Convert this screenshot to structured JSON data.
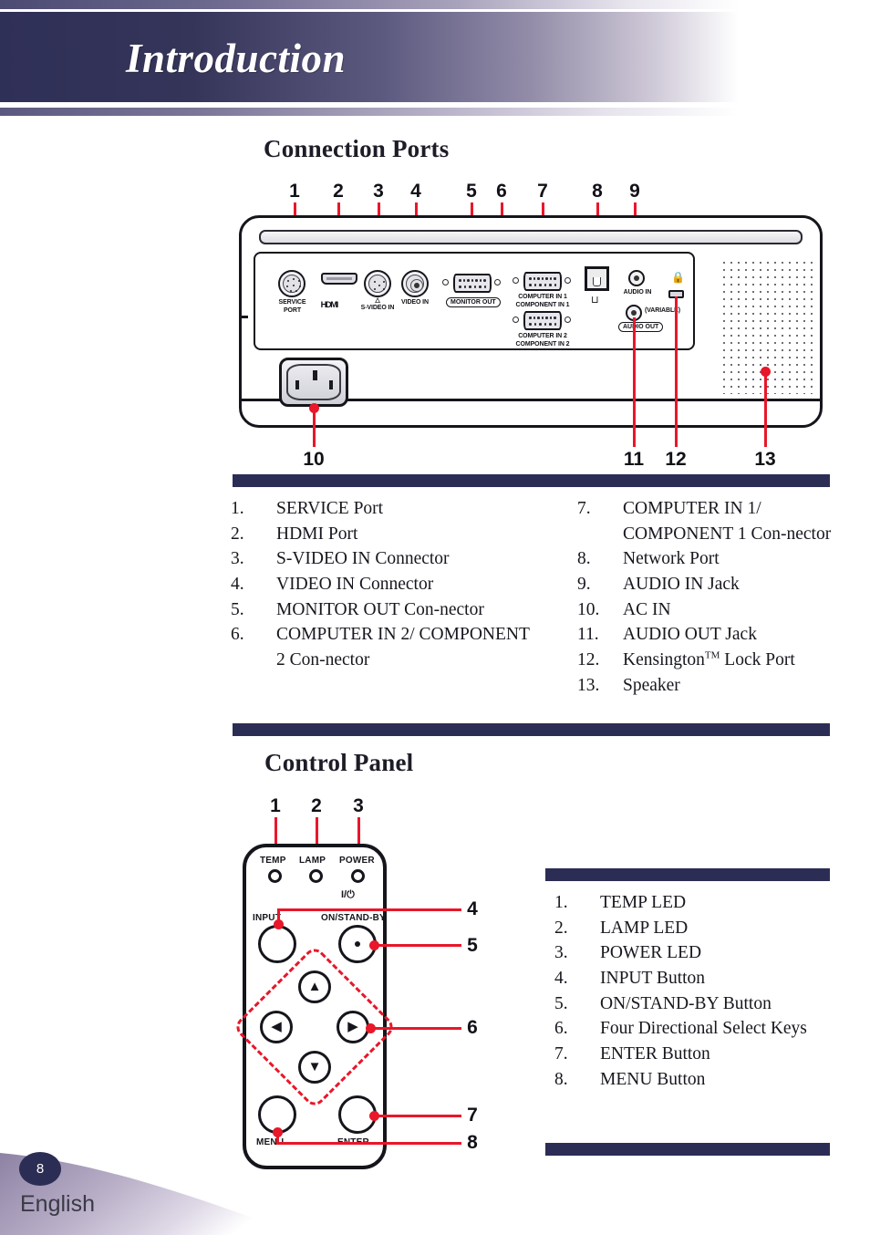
{
  "header": {
    "title": "Introduction"
  },
  "sections": {
    "connection_ports": {
      "heading": "Connection Ports"
    },
    "control_panel": {
      "heading": "Control Panel"
    }
  },
  "ports_diagram": {
    "callouts_top": [
      "1",
      "2",
      "3",
      "4",
      "5",
      "6",
      "7",
      "8",
      "9"
    ],
    "callouts_bottom": [
      "10",
      "11",
      "12",
      "13"
    ],
    "labels": {
      "service_port": "SERVICE\nPORT",
      "hdmi": "HDMI",
      "s_video_in": "S-VIDEO IN",
      "video_in": "VIDEO IN",
      "monitor_out": "MONITOR OUT",
      "computer_in_1": "COMPUTER IN 1\nCOMPONENT IN 1",
      "computer_in_2": "COMPUTER IN 2\nCOMPONENT IN 2",
      "audio_in": "AUDIO IN",
      "audio_out": "AUDIO OUT",
      "variable": "(VARIABLE)"
    }
  },
  "ports_list": {
    "left": [
      {
        "num": "1.",
        "text": "SERVICE Port"
      },
      {
        "num": "2.",
        "text": "HDMI Port"
      },
      {
        "num": "3.",
        "text": "S-VIDEO IN Connector"
      },
      {
        "num": "4.",
        "text": "VIDEO IN Connector"
      },
      {
        "num": "5.",
        "text": "MONITOR OUT Con-nector"
      },
      {
        "num": "6.",
        "text": "COMPUTER IN 2/ COMPONENT 2 Con-nector"
      }
    ],
    "right": [
      {
        "num": "7.",
        "text": "COMPUTER IN 1/ COMPONENT 1 Con-nector"
      },
      {
        "num": "8.",
        "text": "Network Port"
      },
      {
        "num": "9.",
        "text": "AUDIO IN Jack"
      },
      {
        "num": "10.",
        "text": "AC IN"
      },
      {
        "num": "11.",
        "text": "AUDIO OUT Jack"
      },
      {
        "num": "12.",
        "text": "Kensington",
        "sup": "TM",
        "text2": " Lock Port"
      },
      {
        "num": "13.",
        "text": "Speaker"
      }
    ]
  },
  "control_panel_diagram": {
    "callouts_top": [
      "1",
      "2",
      "3"
    ],
    "callouts_right": [
      "4",
      "5",
      "6",
      "7",
      "8"
    ],
    "labels": {
      "temp": "TEMP",
      "lamp": "LAMP",
      "power": "POWER",
      "input": "INPUT",
      "on_standby": "ON/STAND-BY",
      "power_symbol": "I/⏻",
      "menu": "MENU",
      "enter": "ENTER"
    }
  },
  "control_panel_list": [
    {
      "num": "1.",
      "text": "TEMP LED"
    },
    {
      "num": "2.",
      "text": "LAMP LED"
    },
    {
      "num": "3.",
      "text": "POWER LED"
    },
    {
      "num": "4.",
      "text": "INPUT Button"
    },
    {
      "num": "5.",
      "text": "ON/STAND-BY Button"
    },
    {
      "num": "6.",
      "text": "Four Directional Select Keys"
    },
    {
      "num": "7.",
      "text": "ENTER Button"
    },
    {
      "num": "8.",
      "text": "MENU Button"
    }
  ],
  "footer": {
    "page_number": "8",
    "language": "English"
  },
  "colors": {
    "navy": "#2b2d54",
    "header_dark": "#2f3058",
    "callout_red": "#e8172a",
    "outline": "#15151c"
  }
}
